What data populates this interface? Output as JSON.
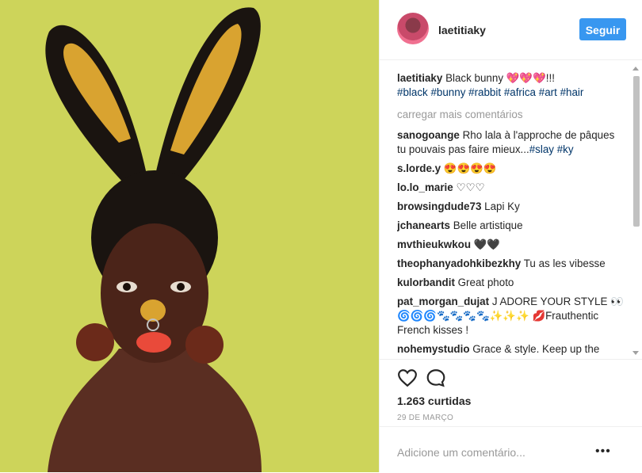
{
  "header": {
    "username": "laetitiaky",
    "follow_label": "Seguir"
  },
  "caption": {
    "username": "laetitiaky",
    "text": "Black bunny 💖💖💖!!!",
    "tags": [
      "#black",
      "#bunny",
      "#rabbit",
      "#africa",
      "#art",
      "#hair"
    ]
  },
  "load_more": "carregar mais comentários",
  "comments": [
    {
      "user": "sanogoange",
      "text": "Rho lala à l'approche de pâques tu pouvais pas faire mieux...",
      "tags": "#slay #ky"
    },
    {
      "user": "s.lorde.y",
      "text": "😍😍😍😍",
      "tags": ""
    },
    {
      "user": "lo.lo_marie",
      "text": "♡♡♡",
      "tags": ""
    },
    {
      "user": "browsingdude73",
      "text": "Lapi Ky",
      "tags": ""
    },
    {
      "user": "jchanearts",
      "text": "Belle artistique",
      "tags": ""
    },
    {
      "user": "mvthieukwkou",
      "text": "🖤🖤",
      "tags": ""
    },
    {
      "user": "theophanyadohkibezkhy",
      "text": "Tu as les vibesse",
      "tags": ""
    },
    {
      "user": "kulorbandit",
      "text": "Great photo",
      "tags": ""
    },
    {
      "user": "pat_morgan_dujat",
      "text": "J ADORE YOUR STYLE 👀🌀🌀🌀🐾🐾🐾🐾✨✨✨ 💋Frauthentic French kisses !",
      "tags": ""
    },
    {
      "user": "nohemystudio",
      "text": "Grace & style. Keep up the",
      "tags": ""
    }
  ],
  "likes": "1.263 curtidas",
  "date": "29 DE MARÇO",
  "add_comment_placeholder": "Adicione um comentário...",
  "more_label": "•••",
  "colors": {
    "accent": "#3897f0",
    "tag": "#003569",
    "photo_bg": "#cfd65a"
  },
  "icons": {
    "like": "heart-icon",
    "comment": "comment-bubble-icon",
    "more": "more-options-icon"
  }
}
